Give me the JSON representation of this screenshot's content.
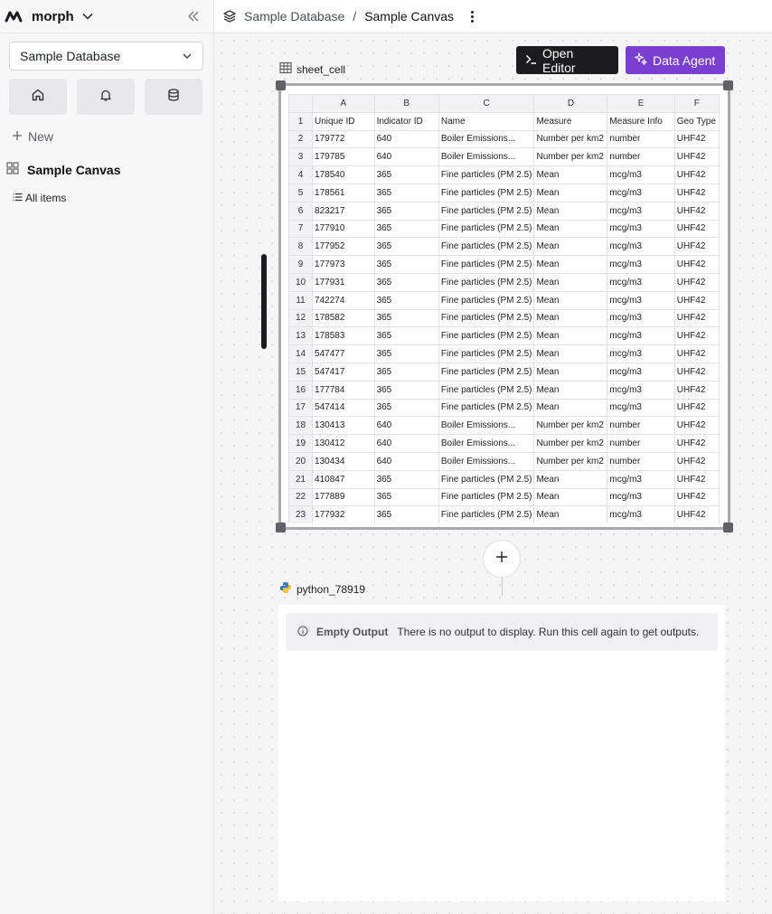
{
  "sidebar": {
    "brand": "morph",
    "database_select": "Sample Database",
    "new_label": "New",
    "canvas_name": "Sample Canvas",
    "all_items_label": "All items"
  },
  "header": {
    "breadcrumb_root": "Sample Database",
    "breadcrumb_separator": "/",
    "breadcrumb_current": "Sample Canvas"
  },
  "toolbar": {
    "open_editor": "Open Editor",
    "data_agent": "Data Agent"
  },
  "sheet_cell": {
    "name": "sheet_cell",
    "columns": [
      "A",
      "B",
      "C",
      "D",
      "E",
      "F"
    ],
    "row_numbers": [
      "1",
      "2",
      "3",
      "4",
      "5",
      "6",
      "7",
      "8",
      "9",
      "10",
      "11",
      "12",
      "13",
      "14",
      "15",
      "16",
      "17",
      "18",
      "19",
      "20",
      "21",
      "22",
      "23"
    ],
    "rows": [
      [
        "Unique ID",
        "Indicator ID",
        "Name",
        "Measure",
        "Measure Info",
        "Geo Type"
      ],
      [
        "179772",
        "640",
        "Boiler Emissions...",
        "Number per km2",
        "number",
        "UHF42"
      ],
      [
        "179785",
        "640",
        "Boiler Emissions...",
        "Number per km2",
        "number",
        "UHF42"
      ],
      [
        "178540",
        "365",
        "Fine particles (PM 2.5)",
        "Mean",
        "mcg/m3",
        "UHF42"
      ],
      [
        "178561",
        "365",
        "Fine particles (PM 2.5)",
        "Mean",
        "mcg/m3",
        "UHF42"
      ],
      [
        "823217",
        "365",
        "Fine particles (PM 2.5)",
        "Mean",
        "mcg/m3",
        "UHF42"
      ],
      [
        "177910",
        "365",
        "Fine particles (PM 2.5)",
        "Mean",
        "mcg/m3",
        "UHF42"
      ],
      [
        "177952",
        "365",
        "Fine particles (PM 2.5)",
        "Mean",
        "mcg/m3",
        "UHF42"
      ],
      [
        "177973",
        "365",
        "Fine particles (PM 2.5)",
        "Mean",
        "mcg/m3",
        "UHF42"
      ],
      [
        "177931",
        "365",
        "Fine particles (PM 2.5)",
        "Mean",
        "mcg/m3",
        "UHF42"
      ],
      [
        "742274",
        "365",
        "Fine particles (PM 2.5)",
        "Mean",
        "mcg/m3",
        "UHF42"
      ],
      [
        "178582",
        "365",
        "Fine particles (PM 2.5)",
        "Mean",
        "mcg/m3",
        "UHF42"
      ],
      [
        "178583",
        "365",
        "Fine particles (PM 2.5)",
        "Mean",
        "mcg/m3",
        "UHF42"
      ],
      [
        "547477",
        "365",
        "Fine particles (PM 2.5)",
        "Mean",
        "mcg/m3",
        "UHF42"
      ],
      [
        "547417",
        "365",
        "Fine particles (PM 2.5)",
        "Mean",
        "mcg/m3",
        "UHF42"
      ],
      [
        "177784",
        "365",
        "Fine particles (PM 2.5)",
        "Mean",
        "mcg/m3",
        "UHF42"
      ],
      [
        "547414",
        "365",
        "Fine particles (PM 2.5)",
        "Mean",
        "mcg/m3",
        "UHF42"
      ],
      [
        "130413",
        "640",
        "Boiler Emissions...",
        "Number per km2",
        "number",
        "UHF42"
      ],
      [
        "130412",
        "640",
        "Boiler Emissions...",
        "Number per km2",
        "number",
        "UHF42"
      ],
      [
        "130434",
        "640",
        "Boiler Emissions...",
        "Number per km2",
        "number",
        "UHF42"
      ],
      [
        "410847",
        "365",
        "Fine particles (PM 2.5)",
        "Mean",
        "mcg/m3",
        "UHF42"
      ],
      [
        "177889",
        "365",
        "Fine particles (PM 2.5)",
        "Mean",
        "mcg/m3",
        "UHF42"
      ],
      [
        "177932",
        "365",
        "Fine particles (PM 2.5)",
        "Mean",
        "mcg/m3",
        "UHF42"
      ]
    ]
  },
  "python_cell": {
    "name": "python_78919",
    "empty_title": "Empty Output",
    "empty_message": "There is no output to display. Run this cell again to get outputs."
  },
  "colors": {
    "data_agent": "#7a3fd0",
    "open_editor": "#1c1c1e"
  },
  "icons": [
    "morph-logo-icon",
    "chevron-down-icon",
    "collapse-sidebar-icon",
    "home-icon",
    "bell-icon",
    "database-icon",
    "plus-icon",
    "grid-icon",
    "list-icon",
    "layers-icon",
    "kebab-icon",
    "terminal-icon",
    "sparkle-icon",
    "table-icon",
    "python-icon",
    "info-icon"
  ]
}
